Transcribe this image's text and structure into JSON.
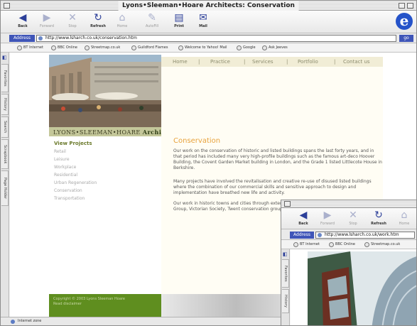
{
  "window": {
    "title": "Lyons•Sleeman•Hoare Architects: Conservation"
  },
  "toolbar": [
    {
      "label": "Back",
      "icon": "back-arrow-icon",
      "enabled": true
    },
    {
      "label": "Forward",
      "icon": "forward-arrow-icon",
      "enabled": false
    },
    {
      "label": "Stop",
      "icon": "stop-x-icon",
      "enabled": false
    },
    {
      "label": "Refresh",
      "icon": "refresh-icon",
      "enabled": true
    },
    {
      "label": "Home",
      "icon": "home-icon",
      "enabled": false
    },
    {
      "label": "AutoFill",
      "icon": "autofill-icon",
      "enabled": false
    },
    {
      "label": "Print",
      "icon": "print-icon",
      "enabled": true
    },
    {
      "label": "Mail",
      "icon": "mail-icon",
      "enabled": true
    }
  ],
  "address": {
    "label": "Address",
    "url": "http://www.lsharch.co.uk/conservation.htm",
    "go_label": "go"
  },
  "favorites": [
    "BT Internet",
    "BBC Online",
    "Streetmap.co.uk",
    "Guildford Flames",
    "Welcome to Yahoo! Mail",
    "Google",
    "Ask Jeeves"
  ],
  "sidetabs": [
    "Favorites",
    "History",
    "Search",
    "Scrapbook",
    "Page Holder"
  ],
  "status": "Internet zone",
  "site": {
    "brand_name": "LYONS•SLEEMAN•HOARE",
    "brand_suffix": "Architects",
    "nav": [
      "Home",
      "Practice",
      "Services",
      "Portfolio",
      "Contact us"
    ],
    "sidenav": [
      "View Projects",
      "Retail",
      "Leisure",
      "Workplace",
      "Residential",
      "Urban Regeneration",
      "Conservation",
      "Transportation"
    ],
    "copyright_line1": "Copyright © 2003 Lyons Sleeman Hoare",
    "copyright_line2": "Read disclaimer",
    "title": "Conservation",
    "para1": "Our work on the conservation of historic and listed buildings spans the last forty years, and in that period has included many very high-profile buildings such as the famous art-deco Hoover Building, the Covent Garden Market building in London, and the Grade 1 listed Littlecote House in Berkshire.",
    "para2": "Many projects have involved the revitalisation and creative re-use of disused listed buildings where the combination of our commercial skills and sensitive approach to design and implementation have breathed new life and activity.",
    "para3": "Our work in historic towns and cities through extensive involvement with statutory bo Georgian Group, Victorian Society, Twent conservation groups and advisers."
  },
  "window2": {
    "toolbar": [
      {
        "label": "Back",
        "icon": "back-arrow-icon",
        "enabled": true
      },
      {
        "label": "Forward",
        "icon": "forward-arrow-icon",
        "enabled": false
      },
      {
        "label": "Stop",
        "icon": "stop-x-icon",
        "enabled": false
      },
      {
        "label": "Refresh",
        "icon": "refresh-icon",
        "enabled": true
      },
      {
        "label": "Home",
        "icon": "home-icon",
        "enabled": false
      }
    ],
    "address": {
      "label": "Address",
      "url": "http://www.lsharch.co.uk/work.htm"
    },
    "favorites": [
      "BT Internet",
      "BBC Online",
      "Streetmap.co.uk"
    ],
    "sidetabs": [
      "Favorites",
      "History"
    ]
  }
}
